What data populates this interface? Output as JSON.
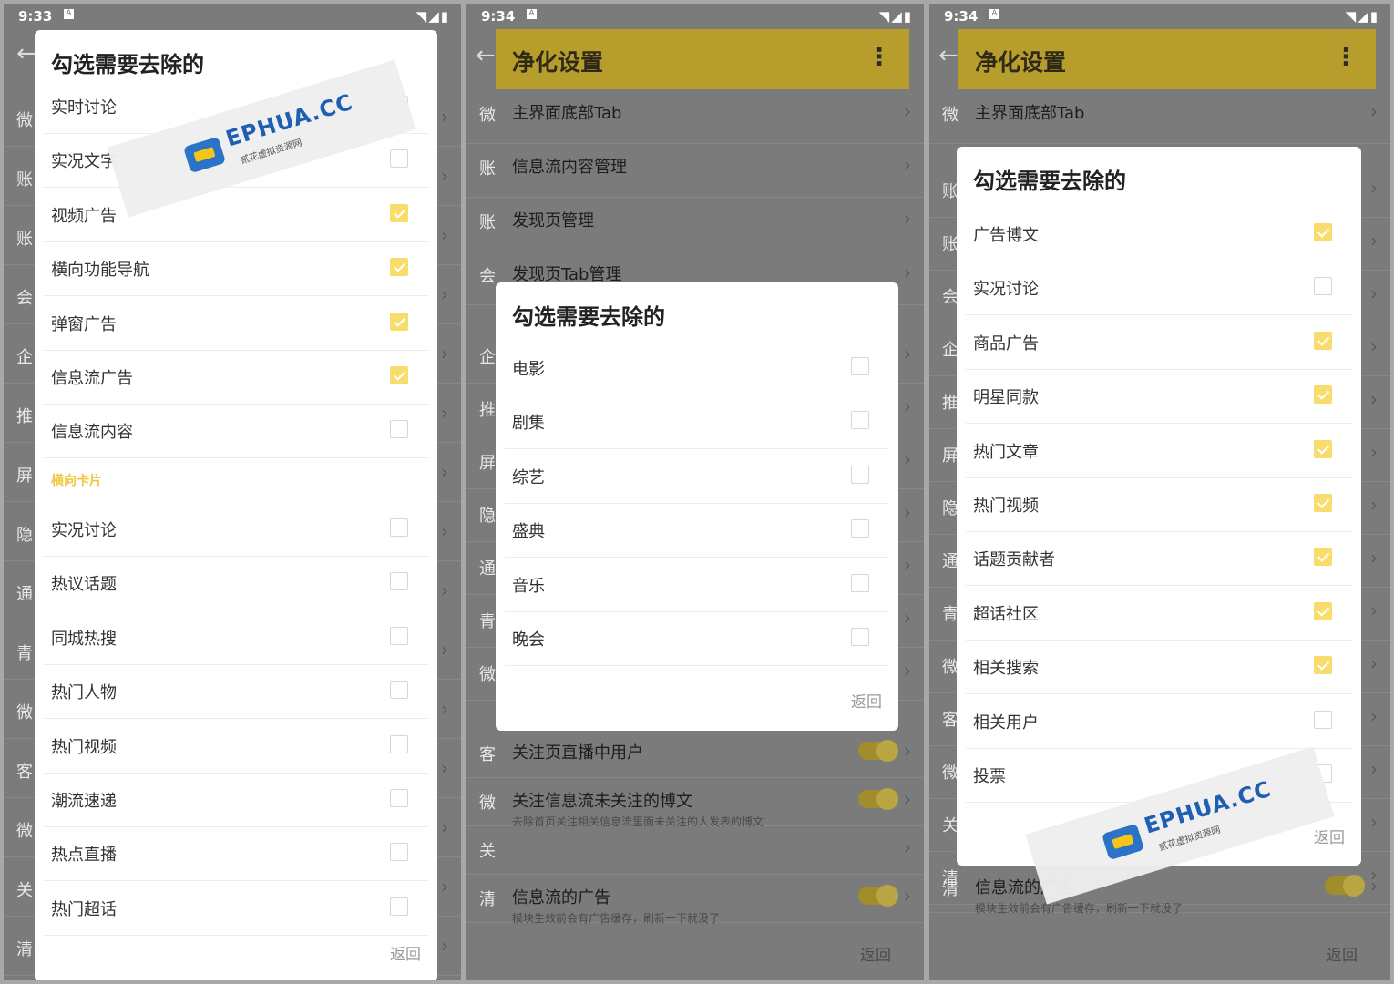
{
  "screens": [
    {
      "time": "9:33",
      "status_icons": "◥◢▮",
      "behind_chars": [
        "微",
        "账",
        "账",
        "会",
        "企",
        "推",
        "屏",
        "隐",
        "通",
        "青",
        "微",
        "客",
        "微",
        "关",
        "清"
      ],
      "dialog": {
        "title": "勾选需要去除的",
        "items": [
          {
            "label": "实时讨论",
            "checked": false
          },
          {
            "label": "实况文字",
            "checked": false
          },
          {
            "label": "视频广告",
            "checked": true
          },
          {
            "label": "横向功能导航",
            "checked": true
          },
          {
            "label": "弹窗广告",
            "checked": true
          },
          {
            "label": "信息流广告",
            "checked": true
          },
          {
            "label": "信息流内容",
            "checked": false
          }
        ],
        "section_label": "横向卡片",
        "section_items": [
          {
            "label": "实况讨论",
            "checked": false
          },
          {
            "label": "热议话题",
            "checked": false
          },
          {
            "label": "同城热搜",
            "checked": false
          },
          {
            "label": "热门人物",
            "checked": false
          },
          {
            "label": "热门视频",
            "checked": false
          },
          {
            "label": "潮流速递",
            "checked": false
          },
          {
            "label": "热点直播",
            "checked": false
          },
          {
            "label": "热门超话",
            "checked": false
          }
        ],
        "return_label": "返回"
      }
    },
    {
      "time": "9:34",
      "status_icons": "◥◢▮",
      "app_title": "净化设置",
      "behind_rows": [
        {
          "ch": "微",
          "label": "主界面底部Tab"
        },
        {
          "ch": "账",
          "label": "信息流内容管理"
        },
        {
          "ch": "账",
          "label": "发现页管理"
        },
        {
          "ch": "会",
          "label": "发现页Tab管理"
        }
      ],
      "behind_chars": [
        "企",
        "推",
        "屏",
        "隐",
        "通",
        "青",
        "微"
      ],
      "bottom_rows": [
        {
          "ch": "客",
          "label": "关注页直播中用户",
          "sub": ""
        },
        {
          "ch": "微",
          "label": "关注信息流未关注的博文",
          "sub": "去除首页关注相关信息流里面未关注的人发表的博文"
        },
        {
          "ch": "关",
          "label": "",
          "sub": ""
        },
        {
          "ch": "清",
          "label": "信息流的广告",
          "sub": "模块生效前会有广告缓存，刷新一下就没了"
        }
      ],
      "dialog": {
        "title": "勾选需要去除的",
        "items": [
          {
            "label": "电影",
            "checked": false
          },
          {
            "label": "剧集",
            "checked": false
          },
          {
            "label": "综艺",
            "checked": false
          },
          {
            "label": "盛典",
            "checked": false
          },
          {
            "label": "音乐",
            "checked": false
          },
          {
            "label": "晚会",
            "checked": false
          }
        ],
        "return_label": "返回"
      },
      "bottom_return": "返回"
    },
    {
      "time": "9:34",
      "status_icons": "◥◢▮",
      "app_title": "净化设置",
      "behind_rows": [
        {
          "ch": "微",
          "label": "主界面底部Tab"
        }
      ],
      "behind_chars": [
        "账",
        "账",
        "会",
        "企",
        "推",
        "屏",
        "隐",
        "通",
        "青",
        "微",
        "客",
        "微",
        "关",
        "清"
      ],
      "bottom_rows": [
        {
          "ch": "清",
          "label": "信息流的广告",
          "sub": "模块生效前会有广告缓存，刷新一下就没了"
        }
      ],
      "dialog": {
        "title": "勾选需要去除的",
        "items": [
          {
            "label": "广告博文",
            "checked": true
          },
          {
            "label": "实况讨论",
            "checked": false
          },
          {
            "label": "商品广告",
            "checked": true
          },
          {
            "label": "明星同款",
            "checked": true
          },
          {
            "label": "热门文章",
            "checked": true
          },
          {
            "label": "热门视频",
            "checked": true
          },
          {
            "label": "话题贡献者",
            "checked": true
          },
          {
            "label": "超话社区",
            "checked": true
          },
          {
            "label": "相关搜索",
            "checked": true
          },
          {
            "label": "相关用户",
            "checked": false
          },
          {
            "label": "投票",
            "checked": false
          }
        ],
        "return_label": "返回"
      },
      "bottom_return": "返回"
    }
  ],
  "watermark": {
    "brand": "EPHUA.CC",
    "slogan": "贰花虚拟资源网"
  }
}
